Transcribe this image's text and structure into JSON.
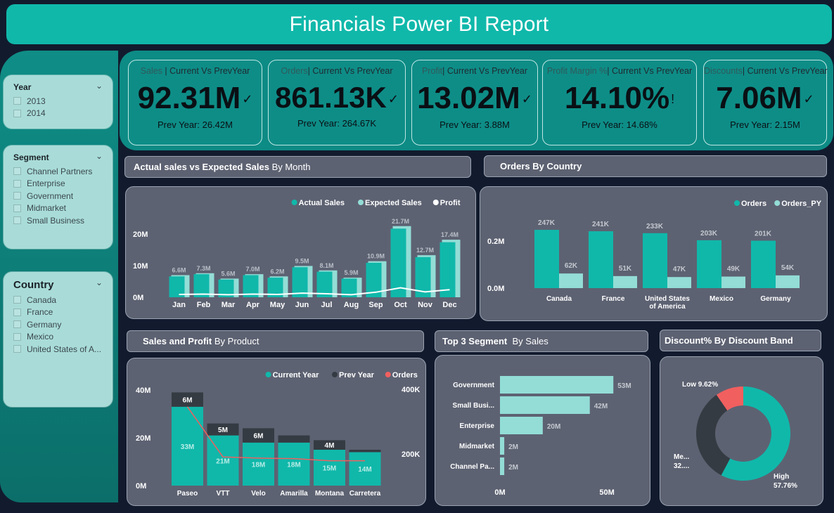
{
  "header": {
    "title": "Financials Power BI Report"
  },
  "slicers": {
    "year": {
      "title": "Year",
      "options": [
        "2013",
        "2014"
      ]
    },
    "segment": {
      "title": "Segment",
      "options": [
        "Channel Partners",
        "Enterprise",
        "Government",
        "Midmarket",
        "Small Business"
      ]
    },
    "country": {
      "title": "Country",
      "options": [
        "Canada",
        "France",
        "Germany",
        "Mexico",
        "United States of A..."
      ]
    }
  },
  "kpis": [
    {
      "prefix": "Sales",
      "suffix": "| Current Vs PrevYear",
      "value": "92.31M",
      "icon": "✓",
      "prev": "Prev Year: 26.42M"
    },
    {
      "prefix": "Orders",
      "suffix": "| Current Vs PrevYear",
      "value": "861.13K",
      "icon": "✓",
      "prev": "Prev Year: 264.67K"
    },
    {
      "prefix": "Profit",
      "suffix": "| Current Vs PrevYear",
      "value": "13.02M",
      "icon": "✓",
      "prev": "Prev Year: 3.88M"
    },
    {
      "prefix": "Profit Margin %",
      "suffix": "| Current Vs PrevYear",
      "value": "14.10%",
      "icon": "!",
      "prev": "Prev Year: 14.68%"
    },
    {
      "prefix": "Discounts",
      "suffix": "| Current Vs PrevYear",
      "value": "7.06M",
      "icon": "✓",
      "prev": "Prev Year: 2.15M"
    }
  ],
  "sections": {
    "sales_month": {
      "bold": "Actual sales vs Expected Sales",
      "rest": " By Month"
    },
    "orders_country": {
      "bold": "Orders By Country",
      "rest": ""
    },
    "sales_product": {
      "bold": "Sales and Profit",
      "rest": " By Product"
    },
    "top_segment": {
      "bold": "Top 3 Segment",
      "rest": "  By Sales"
    },
    "discount_band": {
      "bold": "Discount% By Discount Band",
      "rest": ""
    }
  },
  "colors": {
    "teal": "#10b8aa",
    "light_teal": "#93ddd6",
    "dark": "#353b42",
    "red": "#f15f5f",
    "card": "#5d6272"
  },
  "chart_data": [
    {
      "id": "sales_by_month",
      "type": "bar",
      "categories": [
        "Jan",
        "Feb",
        "Mar",
        "Apr",
        "May",
        "Jun",
        "Jul",
        "Aug",
        "Sep",
        "Oct",
        "Nov",
        "Dec"
      ],
      "series": [
        {
          "name": "Actual Sales",
          "values": [
            6.6,
            7.3,
            5.6,
            7.0,
            6.2,
            9.5,
            8.1,
            5.9,
            10.9,
            21.7,
            12.7,
            17.4
          ]
        },
        {
          "name": "Expected Sales",
          "values": [
            7.0,
            7.6,
            5.9,
            7.3,
            6.6,
            9.9,
            8.5,
            6.2,
            11.4,
            22.5,
            13.3,
            18.2
          ]
        },
        {
          "name": "Profit",
          "values": [
            0.9,
            1.0,
            0.8,
            1.0,
            0.9,
            1.3,
            1.1,
            0.8,
            1.6,
            3.0,
            1.7,
            2.4
          ]
        }
      ],
      "data_labels": [
        "6.6M",
        "7.3M",
        "5.6M",
        "7.0M",
        "6.2M",
        "9.5M",
        "8.1M",
        "5.9M",
        "10.9M",
        "21.7M",
        "12.7M",
        "17.4M"
      ],
      "y_ticks": [
        "0M",
        "10M",
        "20M"
      ],
      "ylim": [
        0,
        24
      ],
      "legend_position": "top-right"
    },
    {
      "id": "orders_by_country",
      "type": "bar",
      "categories": [
        "Canada",
        "France",
        "United States of America",
        "Mexico",
        "Germany"
      ],
      "category_lines": [
        [
          "Canada"
        ],
        [
          "France"
        ],
        [
          "United States",
          "of America"
        ],
        [
          "Mexico"
        ],
        [
          "Germany"
        ]
      ],
      "series": [
        {
          "name": "Orders",
          "values": [
            247,
            241,
            233,
            203,
            201
          ],
          "labels": [
            "247K",
            "241K",
            "233K",
            "203K",
            "201K"
          ]
        },
        {
          "name": "Orders_PY",
          "values": [
            62,
            51,
            47,
            49,
            54
          ],
          "labels": [
            "62K",
            "51K",
            "47K",
            "49K",
            "54K"
          ]
        }
      ],
      "y_ticks": [
        "0.0M",
        "0.2M"
      ],
      "ylim": [
        0,
        280
      ],
      "legend_position": "top-right"
    },
    {
      "id": "sales_profit_by_product",
      "type": "bar",
      "categories": [
        "Paseo",
        "VTT",
        "Velo",
        "Amarilla",
        "Montana",
        "Carretera"
      ],
      "series": [
        {
          "name": "Current Year",
          "values": [
            33,
            21,
            18,
            18,
            15,
            14
          ],
          "labels": [
            "33M",
            "21M",
            "18M",
            "18M",
            "15M",
            "14M"
          ]
        },
        {
          "name": "Prev Year",
          "values": [
            6,
            5,
            6,
            3,
            4,
            1
          ],
          "labels": [
            "6M",
            "5M",
            "6M",
            "",
            "4M",
            ""
          ]
        },
        {
          "name": "Orders",
          "values": [
            330,
            120,
            115,
            113,
            104,
            104
          ]
        }
      ],
      "y_ticks_left": [
        "0M",
        "20M",
        "40M"
      ],
      "y_ticks_right": [
        "200K",
        "400K"
      ],
      "ylim": [
        0,
        40
      ],
      "legend_position": "top-right"
    },
    {
      "id": "top_segment_by_sales",
      "type": "bar",
      "orientation": "horizontal",
      "categories": [
        "Government",
        "Small Busi...",
        "Enterprise",
        "Midmarket",
        "Channel Pa..."
      ],
      "values": [
        53,
        42,
        20,
        2,
        2
      ],
      "labels": [
        "53M",
        "42M",
        "20M",
        "2M",
        "2M"
      ],
      "x_ticks": [
        "0M",
        "50M"
      ],
      "xlim": [
        0,
        60
      ]
    },
    {
      "id": "discount_by_band",
      "type": "pie",
      "donut": true,
      "slices": [
        {
          "name": "High",
          "value": 57.76,
          "label": "High",
          "pct": "57.76%"
        },
        {
          "name": "Medium",
          "value": 32.62,
          "label": "Me...",
          "pct": "32...."
        },
        {
          "name": "Low",
          "value": 9.62,
          "label": "Low 9.62%",
          "pct": ""
        }
      ]
    }
  ]
}
